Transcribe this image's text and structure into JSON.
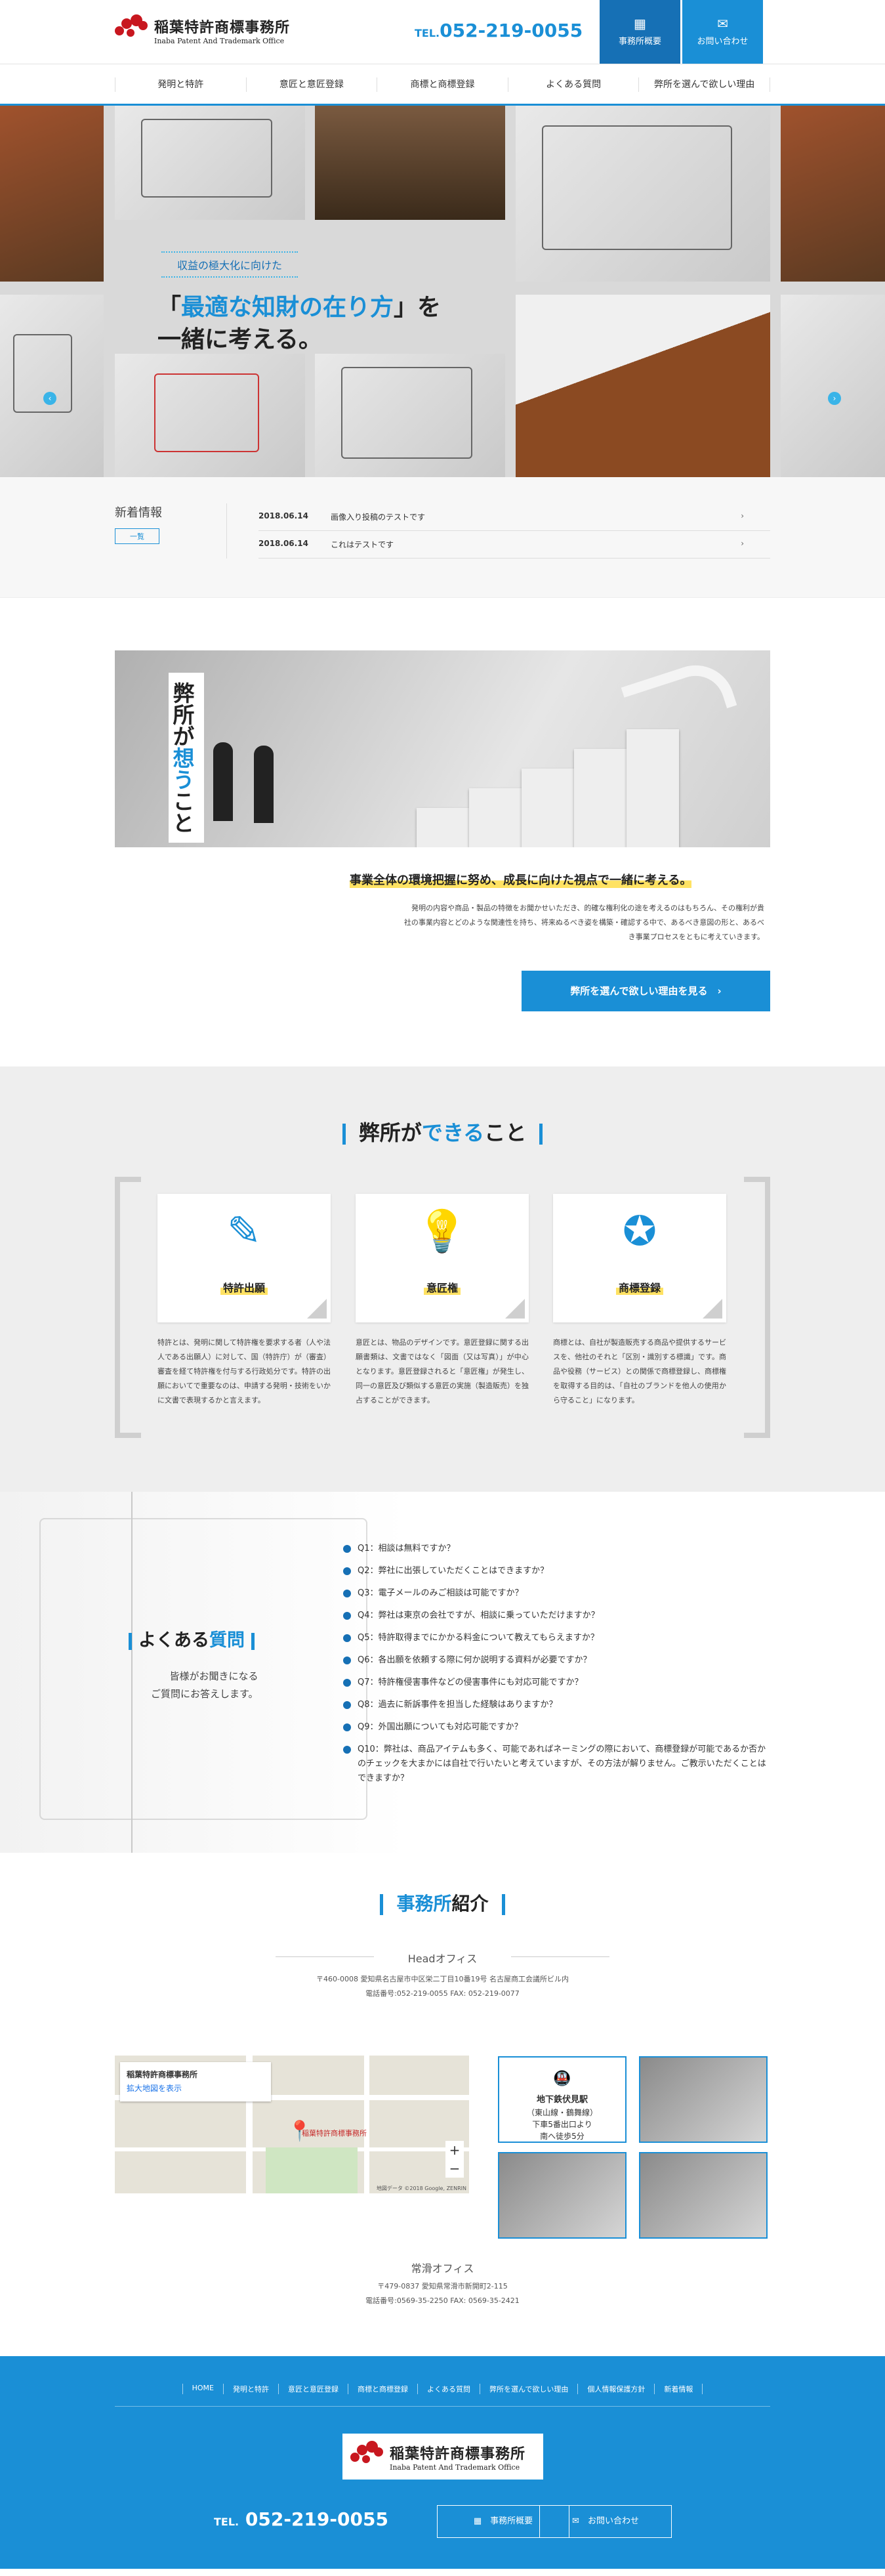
{
  "header": {
    "logo_jp": "稲葉特許商標事務所",
    "logo_en": "Inaba Patent And Trademark Office",
    "tel_prefix": "TEL.",
    "tel": "052-219-0055",
    "btn_office": "事務所概要",
    "btn_contact": "お問い合わせ"
  },
  "nav": [
    "発明と特許",
    "意匠と意匠登録",
    "商標と商標登録",
    "よくある質問",
    "弊所を選んで欲しい理由"
  ],
  "hero": {
    "pre": "収益の極大化に向けた",
    "main_open": "「",
    "main_blue": "最適な知財の在り方",
    "main_close": "」を",
    "main_line2": "一緒に考える。"
  },
  "news": {
    "heading": "新着情報",
    "list_btn": "一覧",
    "items": [
      {
        "date": "2018.06.14",
        "title": "画像入り投稿のテストです"
      },
      {
        "date": "2018.06.14",
        "title": "これはテストです"
      }
    ]
  },
  "think": {
    "title_a": "弊所が",
    "title_b": "想う",
    "title_c": "こと",
    "sub": "事業全体の環境把握に努め、成長に向けた視点で一緒に考える。",
    "text1": "発明の内容や商品・製品の特徴をお聞かせいただき、的確な権利化の途を考えるのはもちろん、その権利が貴",
    "text2": "社の事業内容とどのような関連性を持ち、将来ぬるべき姿を構築・確認する中で、あるべき意図の形と、あるべ",
    "text3": "き事業プロセスをともに考えていきます。",
    "btn": "弊所を選んで欲しい理由を見る"
  },
  "can": {
    "title_a": "弊所が",
    "title_b": "できる",
    "title_c": "こと",
    "cards": [
      {
        "label": "特許出願",
        "text": "特許とは、発明に関して特許権を要求する者（人や法人である出願人）に対して、国（特許庁）が（審査）審査を経て特許権を付与する行政処分です。特許の出願においてで重要なのは、申請する発明・技術をいかに文書で表現するかと言えます。"
      },
      {
        "label": "意匠権",
        "text": "意匠とは、物品のデザインです。意匠登録に関する出願書類は、文書ではなく「図面（又は写真）」が中心となります。意匠登録されると「意匠権」が発生し、同一の意匠及び類似する意匠の実施（製造販売）を独占することができます。"
      },
      {
        "label": "商標登録",
        "text": "商標とは、自社が製造販売する商品や提供するサービスを、他社のそれと「区別・識別する標識」です。商品や役務（サービス）との関係で商標登録し、商標権を取得する目的は、「自社のブランドを他人の使用から守ること」になります。"
      }
    ]
  },
  "faq": {
    "title_a": "よくある",
    "title_b": "質問",
    "sub1": "皆様がお聞きになる",
    "sub2": "ご質問にお答えします。",
    "items": [
      "Q1：相談は無料ですか？",
      "Q2：弊社に出張していただくことはできますか？",
      "Q3：電子メールのみご相談は可能ですか？",
      "Q4：弊社は東京の会社ですが、相談に乗っていただけますか？",
      "Q5：特許取得までにかかる料金について教えてもらえますか？",
      "Q6：各出願を依頼する際に何か説明する資料が必要ですか？",
      "Q7：特許権侵害事件などの侵害事件にも対応可能ですか？",
      "Q8：過去に新訴事件を担当した経験はありますか？",
      "Q9：外国出願についても対応可能ですか？",
      "Q10：弊社は、商品アイテムも多く、可能であればネーミングの際において、商標登録が可能であるか否かのチェックを大まかには自社で行いたいと考えていますが、その方法が解りません。ご教示いただくことはできますか？"
    ]
  },
  "office": {
    "title_a": "事務所",
    "title_b": "紹介",
    "head_label": "Headオフィス",
    "head_addr": "〒460-0008 愛知県名古屋市中区栄二丁目10番19号 名古屋商工会議所ビル内",
    "head_tel": "電話番号:052-219-0055 FAX: 052-219-0077",
    "map_name": "稲葉特許商標事務所",
    "map_link": "拡大地図を表示",
    "map_pin": "稲葉特許商標事務所",
    "map_credit": "地図データ ©2018 Google, ZENRIN",
    "station_a": "地下鉄伏見駅",
    "station_b": "（東山線・鶴舞線）",
    "station_c": "下車5番出口より",
    "station_d": "南へ徒歩5分",
    "branch_label": "常滑オフィス",
    "branch_addr": "〒479-0837 愛知県常滑市新開町2-115",
    "branch_tel": "電話番号:0569-35-2250 FAX: 0569-35-2421"
  },
  "footer": {
    "nav": [
      "HOME",
      "発明と特許",
      "意匠と意匠登録",
      "商標と商標登録",
      "よくある質問",
      "弊所を選んで欲しい理由",
      "個人情報保護方針",
      "新着情報"
    ],
    "tel_prefix": "TEL.",
    "tel": "052-219-0055",
    "btn_office": "事務所概要",
    "btn_contact": "お問い合わせ"
  },
  "colors": {
    "brand": "#1a8fd6",
    "brand_dark": "#1670b5",
    "logo_red": "#c8171f",
    "highlight": "#ffe263"
  }
}
